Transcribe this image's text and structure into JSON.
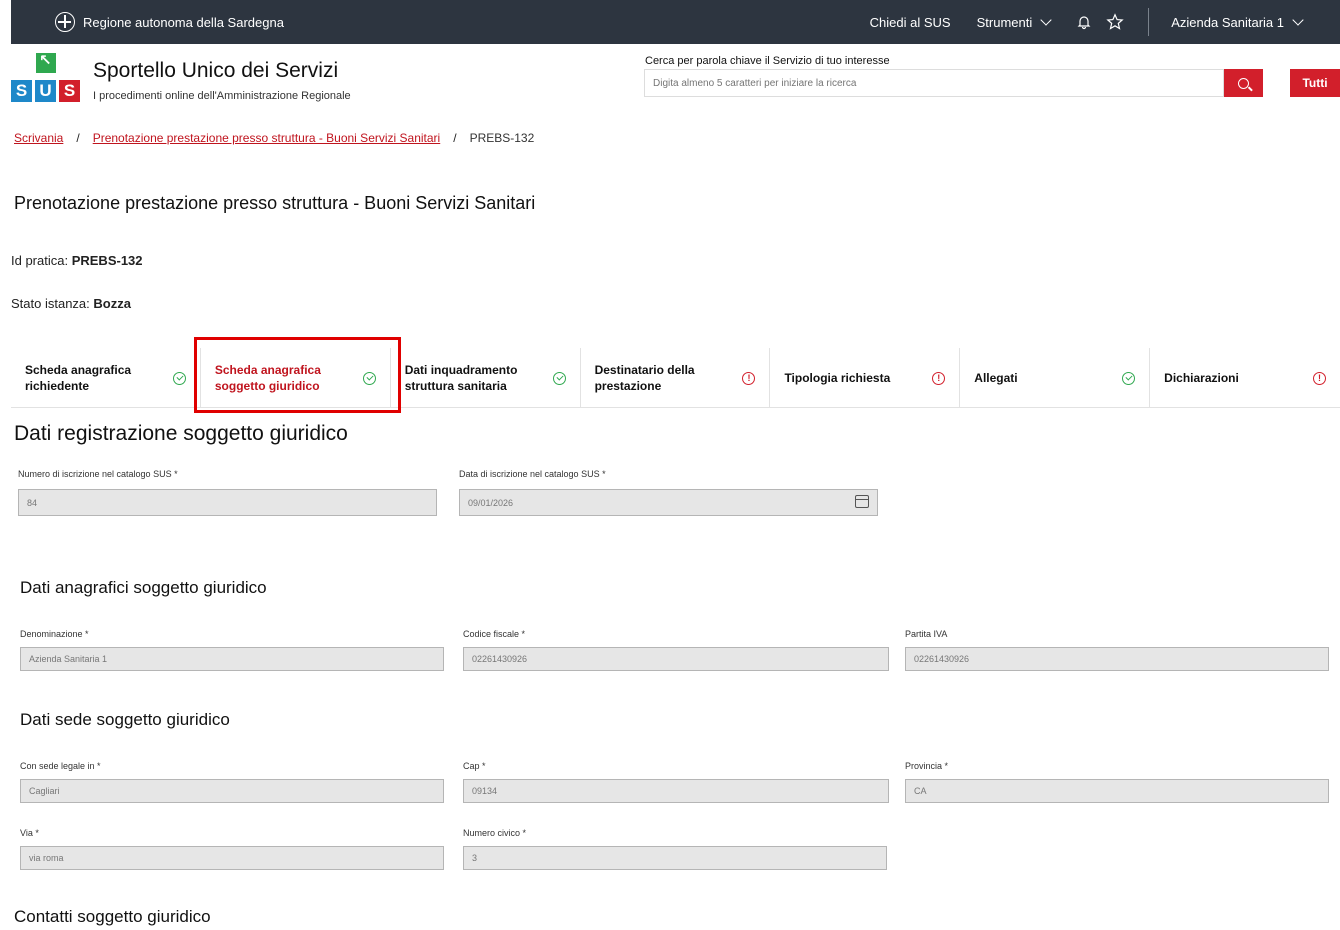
{
  "topbar": {
    "region": "Regione autonoma della Sardegna",
    "chiedi": "Chiedi al SUS",
    "strumenti": "Strumenti",
    "azienda": "Azienda Sanitaria 1"
  },
  "header": {
    "logo_letters": [
      "S",
      "U",
      "S"
    ],
    "title": "Sportello Unico dei Servizi",
    "subtitle": "I procedimenti online dell'Amministrazione Regionale",
    "search_label": "Cerca per parola chiave il Servizio di tuo interesse",
    "search_placeholder": "Digita almeno 5 caratteri per iniziare la ricerca",
    "tutti": "Tutti"
  },
  "breadcrumb": {
    "items": [
      "Scrivania",
      "Prenotazione prestazione presso struttura - Buoni Servizi Sanitari"
    ],
    "separator": "/",
    "current": "PREBS-132"
  },
  "page": {
    "title": "Prenotazione prestazione presso struttura - Buoni Servizi Sanitari",
    "id_label": "Id pratica: ",
    "id_value": "PREBS-132",
    "stato_label": "Stato istanza: ",
    "stato_value": "Bozza"
  },
  "steps": [
    {
      "label": "Scheda anagrafica richiedente",
      "status": "ok"
    },
    {
      "label": "Scheda anagrafica soggetto giuridico",
      "status": "ok",
      "active": true
    },
    {
      "label": "Dati inquadramento struttura sanitaria",
      "status": "ok"
    },
    {
      "label": "Destinatario della prestazione",
      "status": "warn"
    },
    {
      "label": "Tipologia richiesta",
      "status": "warn"
    },
    {
      "label": "Allegati",
      "status": "ok"
    },
    {
      "label": "Dichiarazioni",
      "status": "warn"
    }
  ],
  "registrazione": {
    "title": "Dati registrazione soggetto giuridico",
    "numero_label": "Numero di iscrizione nel catalogo SUS *",
    "numero_value": "84",
    "data_label": "Data di iscrizione nel catalogo SUS *",
    "data_value": "09/01/2026"
  },
  "anagrafici": {
    "title": "Dati anagrafici soggetto giuridico",
    "denominazione_label": "Denominazione *",
    "denominazione_value": "Azienda Sanitaria 1",
    "cf_label": "Codice fiscale *",
    "cf_value": "02261430926",
    "piva_label": "Partita IVA",
    "piva_value": "02261430926"
  },
  "sede": {
    "title": "Dati sede soggetto giuridico",
    "sede_label": "Con sede legale in *",
    "sede_value": "Cagliari",
    "cap_label": "Cap *",
    "cap_value": "09134",
    "prov_label": "Provincia *",
    "prov_value": "CA",
    "via_label": "Via *",
    "via_value": "via roma",
    "civico_label": "Numero civico *",
    "civico_value": "3"
  },
  "contatti": {
    "title": "Contatti soggetto giuridico"
  }
}
